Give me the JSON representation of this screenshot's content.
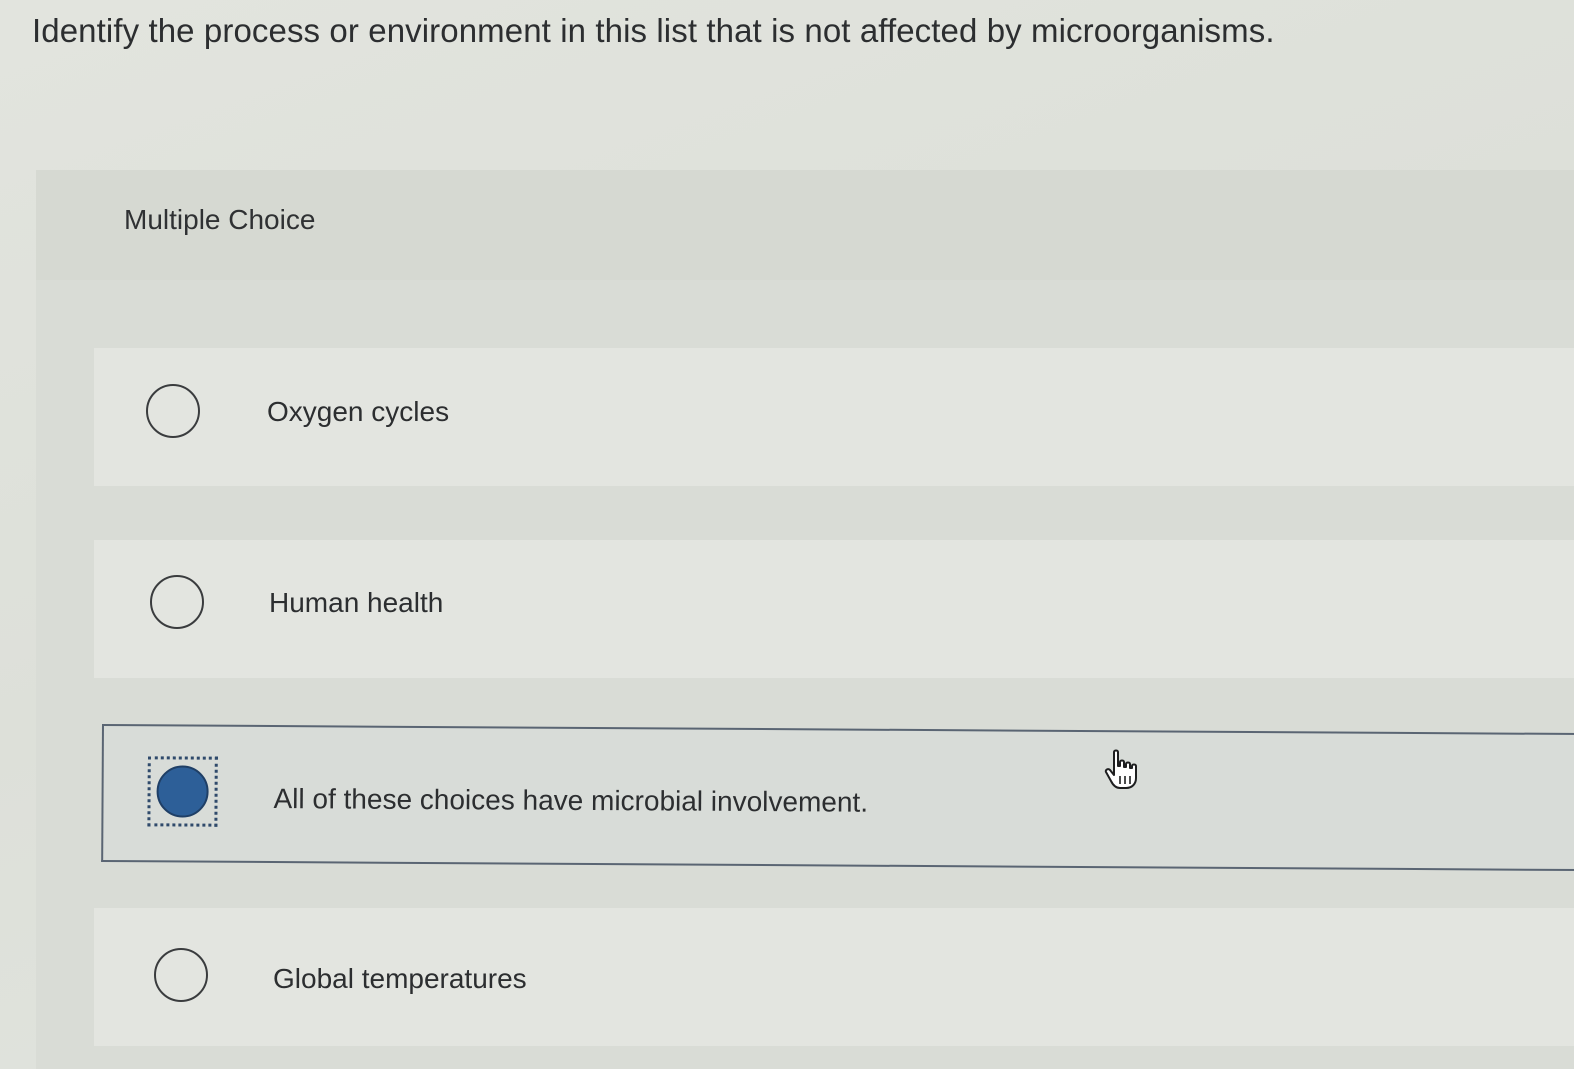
{
  "question": {
    "text": "Identify the process or environment in this list that is not affected by microorganisms."
  },
  "panel": {
    "label": "Multiple Choice"
  },
  "options": [
    {
      "label": "Oxygen cycles",
      "selected": false
    },
    {
      "label": "Human health",
      "selected": false
    },
    {
      "label": "All of these choices have microbial involvement.",
      "selected": true
    },
    {
      "label": "Global temperatures",
      "selected": false
    }
  ],
  "colors": {
    "selected_radio": "#2d5f98",
    "selected_border": "#5a6573"
  },
  "cursor": {
    "icon": "hand-pointer-icon"
  }
}
